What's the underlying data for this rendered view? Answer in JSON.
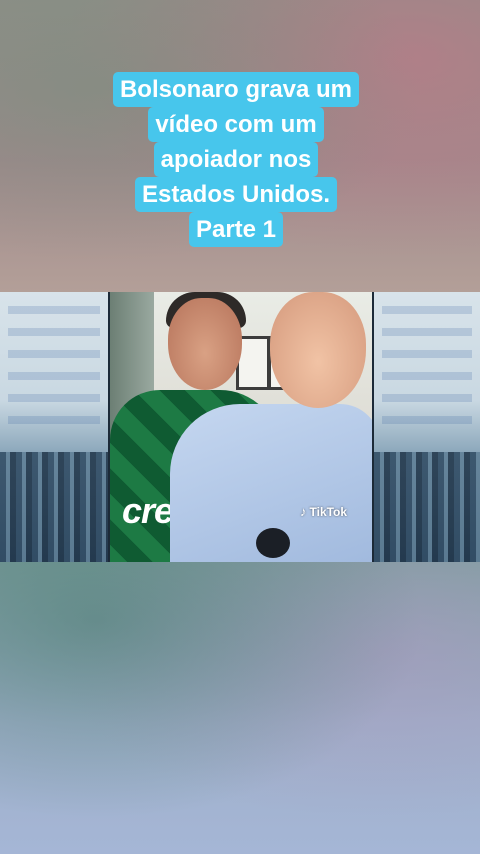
{
  "caption": {
    "lines": [
      "Bolsonaro grava um",
      "vídeo com um",
      "apoiador nos",
      "Estados Unidos.",
      "Parte 1"
    ]
  },
  "video": {
    "jersey_text": "crefi",
    "watermark": {
      "brand": "TikTok",
      "icon": "tiktok-note-icon"
    }
  },
  "colors": {
    "caption_bg": "#47c6ec",
    "caption_text": "#ffffff"
  }
}
